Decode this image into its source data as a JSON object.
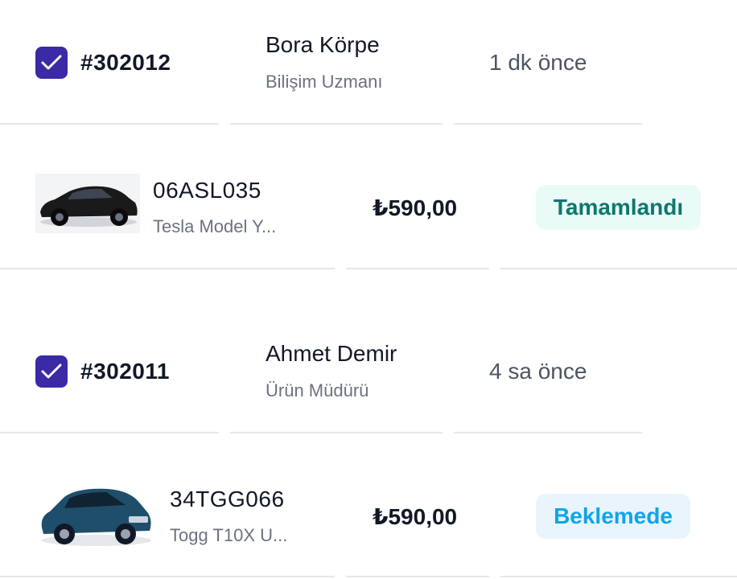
{
  "orders": [
    {
      "order_id": "#302012",
      "checked": true,
      "customer_name": "Bora Körpe",
      "customer_role": "Bilişim Uzmanı",
      "time_ago": "1 dk önce",
      "vehicle": {
        "plate": "06ASL035",
        "model": "Tesla Model Y...",
        "image": "black-suv-car",
        "color": "#1a1a1a"
      },
      "price": "₺590,00",
      "status": {
        "label": "Tamamlandı",
        "text_color": "#0f766e",
        "bg_color": "#e9fbf7"
      }
    },
    {
      "order_id": "#302011",
      "checked": true,
      "customer_name": "Ahmet Demir",
      "customer_role": "Ürün Müdürü",
      "time_ago": "4 sa önce",
      "vehicle": {
        "plate": "34TGG066",
        "model": "Togg T10X U...",
        "image": "blue-suv-car",
        "color": "#1f4e6b"
      },
      "price": "₺590,00",
      "status": {
        "label": "Beklemede",
        "text_color": "#0ea5e9",
        "bg_color": "#eaf4fd"
      }
    }
  ],
  "colors": {
    "checkbox": "#3b2aa6",
    "divider": "#e5e7eb",
    "muted_text": "#6b7280"
  }
}
